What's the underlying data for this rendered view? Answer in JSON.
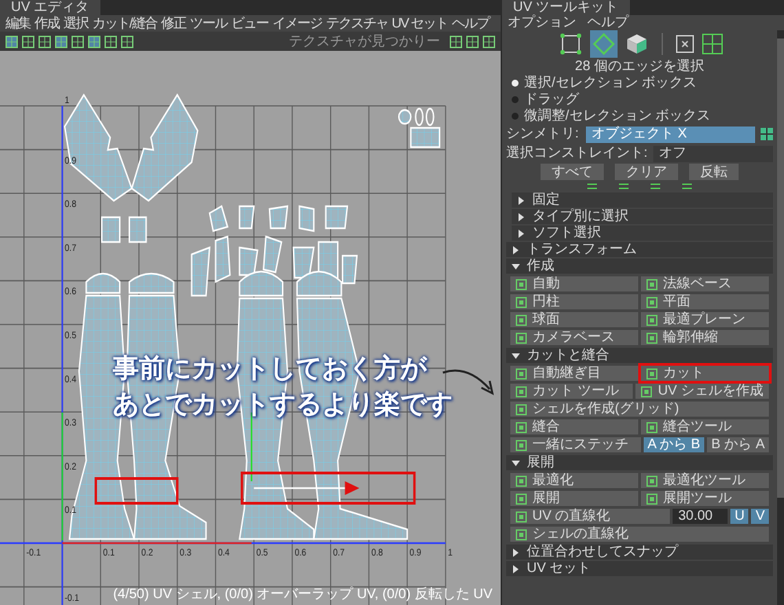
{
  "uv_editor": {
    "title": "UV エディタ",
    "menu": [
      "編集",
      "作成",
      "選択",
      "カット/縫合",
      "修正",
      "ツール",
      "ビュー",
      "イメージ",
      "テクスチャ",
      "UV セット",
      "ヘルプ"
    ],
    "texture_dropdown": "テクスチャが見つかりー",
    "u_ticks": [
      "-0.1",
      "0.1",
      "0.2",
      "0.3",
      "0.4",
      "0.5",
      "0.6",
      "0.7",
      "0.8",
      "0.9",
      "1"
    ],
    "v_ticks": [
      "1",
      "0.9",
      "0.8",
      "0.7",
      "0.6",
      "0.5",
      "0.4",
      "0.3",
      "0.2",
      "0.1",
      "-0.1"
    ],
    "annotation": [
      "事前にカットしておく方が",
      "あとでカットするより楽です"
    ],
    "status": "(4/50) UV シェル, (0/0) オーバーラップ UV, (0/0) 反転した UV"
  },
  "uv_toolkit": {
    "title": "UV ツールキット",
    "menu": [
      "オプション",
      "ヘルプ"
    ],
    "selection_modes": [
      {
        "kind": "vertex",
        "selected": false
      },
      {
        "kind": "edge",
        "selected": true
      },
      {
        "kind": "face",
        "selected": false
      }
    ],
    "selection_count": "28 個のエッジを選択",
    "selection_styles": [
      {
        "label": "選択/セレクション ボックス",
        "selected": true
      },
      {
        "label": "ドラッグ",
        "selected": false
      },
      {
        "label": "微調整/セレクション ボックス",
        "selected": false
      }
    ],
    "symmetry": {
      "label": "シンメトリ:",
      "value": "オブジェクト X"
    },
    "constraint": {
      "label": "選択コンストレイント:",
      "value": "オフ"
    },
    "selection_buttons": [
      "すべて",
      "クリア",
      "反転"
    ],
    "selection_options": [
      {
        "title": "固定",
        "expanded": false
      },
      {
        "title": "タイプ別に選択",
        "expanded": false
      },
      {
        "title": "ソフト選択",
        "expanded": false
      }
    ],
    "sections": [
      {
        "title": "トランスフォーム",
        "expanded": false
      },
      {
        "title": "作成",
        "expanded": true,
        "items": [
          {
            "kind": "tool",
            "label": "自動",
            "annotated": false
          },
          {
            "kind": "tool",
            "label": "法線ベース",
            "annotated": false
          },
          {
            "kind": "tool",
            "label": "円柱",
            "annotated": false
          },
          {
            "kind": "tool",
            "label": "平面",
            "annotated": false
          },
          {
            "kind": "tool",
            "label": "球面",
            "annotated": false
          },
          {
            "kind": "tool",
            "label": "最適プレーン",
            "annotated": false
          },
          {
            "kind": "tool",
            "label": "カメラベース",
            "annotated": false
          },
          {
            "kind": "tool",
            "label": "輪郭伸縮",
            "annotated": false
          }
        ]
      },
      {
        "title": "カットと縫合",
        "expanded": true,
        "items": [
          {
            "kind": "tool",
            "label": "自動継ぎ目",
            "annotated": false
          },
          {
            "kind": "tool",
            "label": "カット",
            "annotated": true
          },
          {
            "kind": "tool",
            "label": "カット ツール",
            "annotated": false
          },
          {
            "kind": "tool",
            "label": "UV シェルを作成",
            "annotated": false
          },
          {
            "kind": "tool",
            "label": "シェルを作成(グリッド)",
            "annotated": false
          },
          {
            "kind": "tool",
            "label": "縫合",
            "annotated": false
          },
          {
            "kind": "tool",
            "label": "縫合ツール",
            "annotated": false
          },
          {
            "kind": "tool",
            "label": "一緒にステッチ",
            "annotated": false
          },
          {
            "kind": "toggle",
            "label": "A から B",
            "selected": true
          },
          {
            "kind": "toggle",
            "label": "B から A",
            "selected": false
          }
        ]
      },
      {
        "title": "展開",
        "expanded": true,
        "items": [
          {
            "kind": "tool",
            "label": "最適化",
            "annotated": false
          },
          {
            "kind": "tool",
            "label": "最適化ツール",
            "annotated": false
          },
          {
            "kind": "tool",
            "label": "展開",
            "annotated": false
          },
          {
            "kind": "tool",
            "label": "展開ツール",
            "annotated": false
          },
          {
            "kind": "tool",
            "label": "UV の直線化",
            "annotated": false
          },
          {
            "kind": "field",
            "value": "30.00"
          },
          {
            "kind": "toggle",
            "label": "U",
            "selected": true
          },
          {
            "kind": "toggle",
            "label": "V",
            "selected": true
          },
          {
            "kind": "tool",
            "label": "シェルの直線化",
            "annotated": false
          }
        ]
      },
      {
        "title": "位置合わせしてスナップ",
        "expanded": false
      },
      {
        "title": "UV セット",
        "expanded": false
      }
    ]
  }
}
